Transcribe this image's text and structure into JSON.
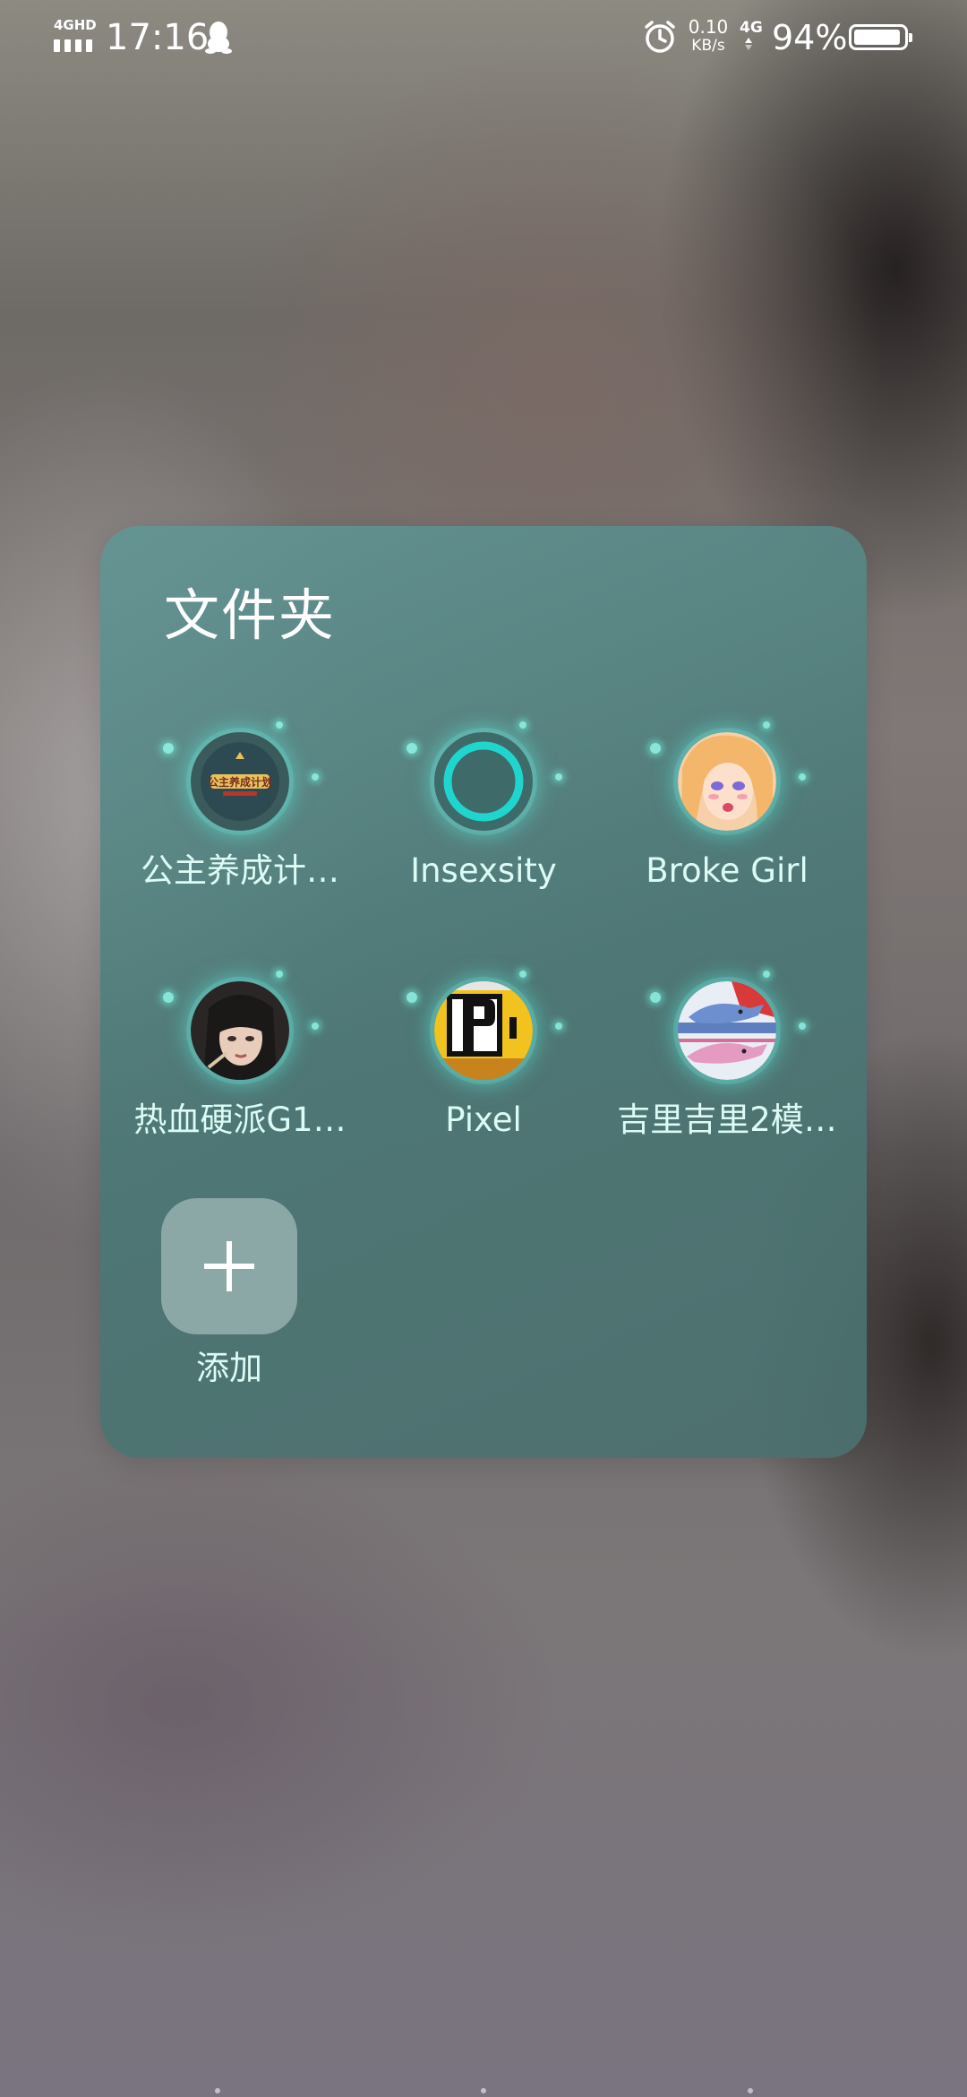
{
  "status_bar": {
    "network": "4GHD",
    "time": "17:16",
    "speed_value": "0.10",
    "speed_unit": "KB/s",
    "net_type": "4G",
    "battery_percent": "94%",
    "battery_level": 0.94,
    "icons": [
      "signal-icon",
      "qq-icon",
      "alarm-icon",
      "net-type-icon",
      "battery-icon"
    ]
  },
  "folder": {
    "title": "文件夹",
    "apps": [
      {
        "label": "公主养成计…",
        "icon": "princess-maker-icon"
      },
      {
        "label": "Insexsity",
        "icon": "insexsity-ring-icon"
      },
      {
        "label": "Broke Girl",
        "icon": "broke-girl-icon"
      },
      {
        "label": "热血硬派G1…",
        "icon": "hot-blood-icon"
      },
      {
        "label": "Pixel",
        "icon": "pixel-p-icon"
      },
      {
        "label": "吉里吉里2模…",
        "icon": "kirikiri-icon"
      }
    ],
    "add_label": "添加",
    "add_icon": "plus-icon",
    "accent_color": "#5ce1d6"
  }
}
